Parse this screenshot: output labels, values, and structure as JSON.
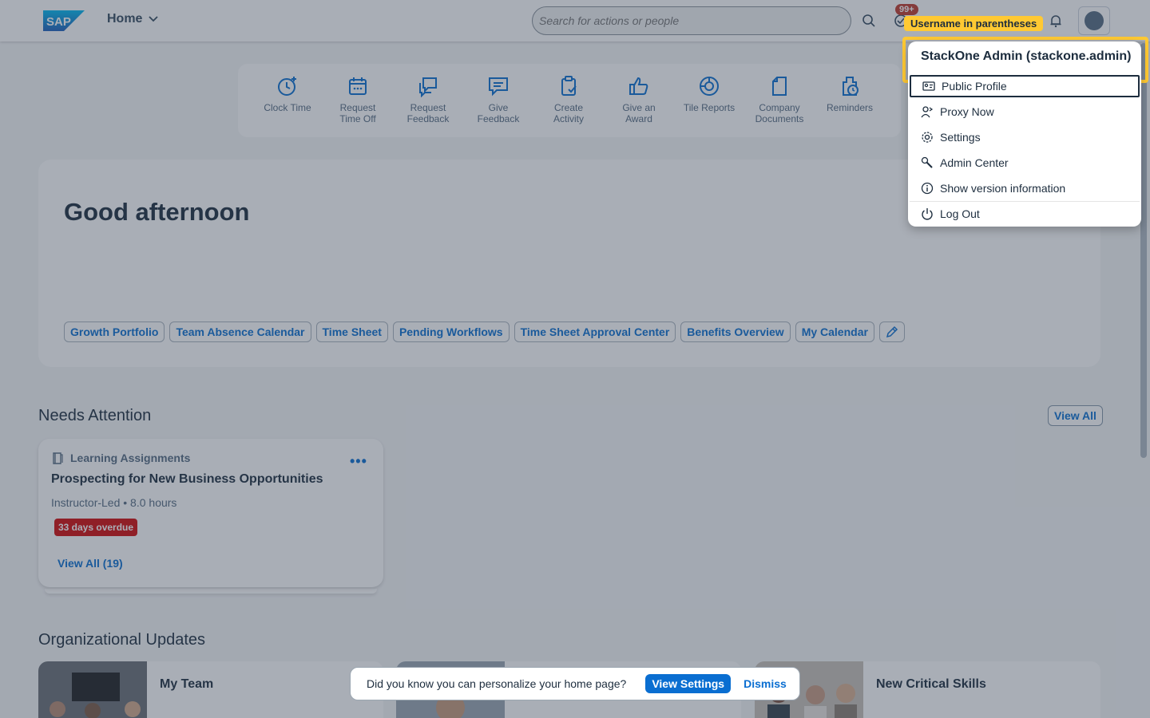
{
  "header": {
    "home_label": "Home",
    "search_placeholder": "Search for actions or people",
    "notification_count": "99+",
    "tooltip": "Username in parentheses"
  },
  "shortcuts": [
    {
      "line1": "Clock Time",
      "line2": "",
      "icon": "clock-add-icon"
    },
    {
      "line1": "Request",
      "line2": "Time Off",
      "icon": "calendar-icon"
    },
    {
      "line1": "Request",
      "line2": "Feedback",
      "icon": "feedback-request-icon"
    },
    {
      "line1": "Give",
      "line2": "Feedback",
      "icon": "feedback-icon"
    },
    {
      "line1": "Create",
      "line2": "Activity",
      "icon": "clipboard-check-icon"
    },
    {
      "line1": "Give an",
      "line2": "Award",
      "icon": "thumbs-up-icon"
    },
    {
      "line1": "Tile Reports",
      "line2": "",
      "icon": "target-icon"
    },
    {
      "line1": "Company",
      "line2": "Documents",
      "icon": "document-icon"
    },
    {
      "line1": "Reminders",
      "line2": "",
      "icon": "reminder-icon"
    }
  ],
  "hero": {
    "greeting": "Good afternoon",
    "links": [
      "Growth Portfolio",
      "Team Absence Calendar",
      "Time Sheet",
      "Pending Workflows",
      "Time Sheet Approval Center",
      "Benefits Overview",
      "My Calendar"
    ]
  },
  "needs_attention": {
    "title": "Needs Attention",
    "view_all": "View All",
    "card": {
      "category": "Learning Assignments",
      "title": "Prospecting for New Business Opportunities",
      "subtitle": "Instructor-Led • 8.0 hours",
      "status": "33 days overdue",
      "status_color": "#d20a0a",
      "link": "View All (19)"
    }
  },
  "org_updates": {
    "title": "Organizational Updates",
    "cards": [
      "My Team",
      "",
      "New Critical Skills"
    ]
  },
  "toast": {
    "message": "Did you know you can personalize your home page?",
    "primary": "View Settings",
    "secondary": "Dismiss"
  },
  "user_menu": {
    "name": "StackOne Admin (stackone.admin)",
    "items": [
      {
        "label": "Public Profile",
        "icon": "id-card-icon"
      },
      {
        "label": "Proxy Now",
        "icon": "proxy-icon"
      },
      {
        "label": "Settings",
        "icon": "gear-icon"
      },
      {
        "label": "Admin Center",
        "icon": "wrench-icon"
      },
      {
        "label": "Show version information",
        "icon": "info-icon"
      },
      {
        "label": "Log Out",
        "icon": "power-icon"
      }
    ]
  },
  "colors": {
    "accent": "#0a6ed1",
    "highlight": "#ffc933",
    "text": "#1d2d3e"
  }
}
